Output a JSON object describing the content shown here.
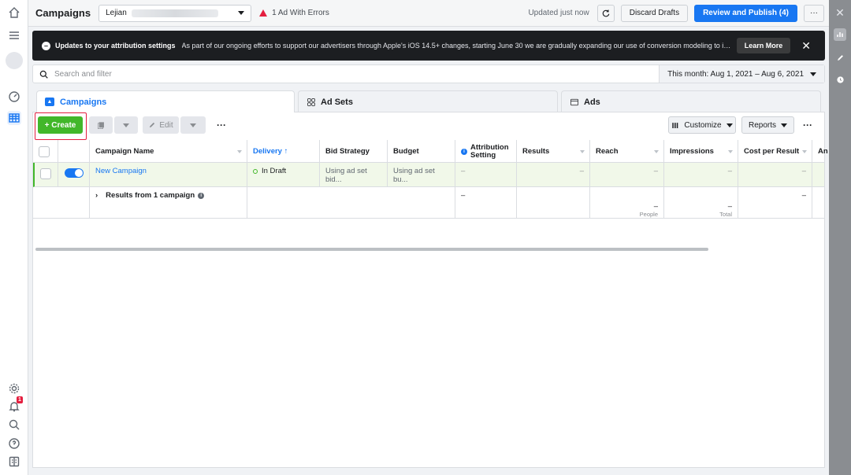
{
  "topbar": {
    "title": "Campaigns",
    "account_name": "Lejian",
    "error_text": "1 Ad With Errors",
    "updated_text": "Updated just now",
    "discard_label": "Discard Drafts",
    "review_label": "Review and Publish (4)",
    "more_label": "···"
  },
  "banner": {
    "title": "Updates to your attribution settings",
    "text": "As part of our ongoing efforts to support our advertisers through Apple's iOS 14.5+ changes, starting June 30 we are gradually expanding our use of conversion modeling to in...",
    "learn_more": "Learn More",
    "close": "✕"
  },
  "search": {
    "placeholder": "Search and filter",
    "date_range": "This month: Aug 1, 2021 – Aug 6, 2021"
  },
  "tabs": [
    {
      "label": "Campaigns"
    },
    {
      "label": "Ad Sets"
    },
    {
      "label": "Ads"
    }
  ],
  "toolbar": {
    "create_label": "+ Create",
    "edit_label": "Edit",
    "more_label": "···",
    "customize_label": "Customize",
    "reports_label": "Reports",
    "panel_more": "···"
  },
  "table": {
    "headers": {
      "name": "Campaign Name",
      "delivery": "Delivery ↑",
      "bid": "Bid Strategy",
      "budget": "Budget",
      "attribution": "Attribution Setting",
      "results": "Results",
      "reach": "Reach",
      "impressions": "Impressions",
      "cpr": "Cost per Result",
      "amount": "An"
    },
    "row": {
      "name": "New Campaign",
      "delivery": "In Draft",
      "bid": "Using ad set bid...",
      "budget": "Using ad set bu...",
      "attribution": "–",
      "results": "–",
      "reach": "–",
      "impressions": "–",
      "cpr": "–"
    },
    "summary": {
      "label": "Results from 1 campaign",
      "attribution": "–",
      "reach": "–",
      "reach_sub": "People",
      "impressions": "–",
      "impressions_sub": "Total",
      "cpr": "–"
    }
  },
  "colors": {
    "accent": "#1877f2",
    "create": "#42b72a",
    "error": "#e41e3f",
    "banner": "#1c1e21"
  },
  "icons": {
    "left_rail": [
      "home-icon",
      "menu-icon",
      "avatar",
      "dashboard-icon",
      "table-grid-icon",
      "settings-gear-icon",
      "notifications-bell-icon",
      "search-icon",
      "help-icon",
      "pages-icon"
    ],
    "right_rail": [
      "close-icon",
      "bar-chart-icon",
      "edit-pencil-icon",
      "history-clock-icon"
    ]
  }
}
